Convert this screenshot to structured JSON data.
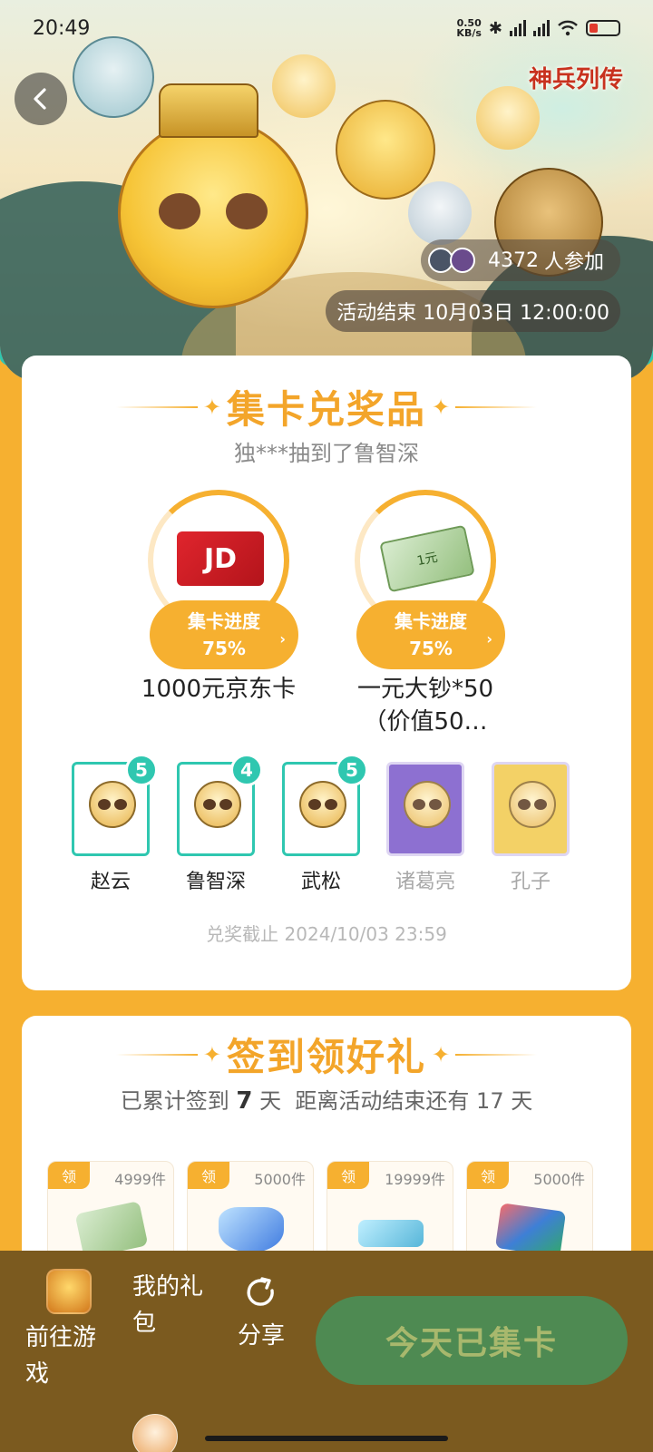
{
  "status_bar": {
    "time": "20:49",
    "net_speed_value": "0.50",
    "net_speed_unit": "KB/s",
    "battery_level": 0.3
  },
  "hero": {
    "logo_text": "神兵列传",
    "participants_count": "4372",
    "participants_suffix": "人参加",
    "end_label": "活动结束 10月03日 12:00:00"
  },
  "collect": {
    "title": "集卡兑奖品",
    "ticker": "独***抽到了鲁智深",
    "prizes": [
      {
        "name": "1000元京东卡",
        "image_text": "JD",
        "progress_label": "集卡进度",
        "progress": "75%",
        "progress_value": 0.75
      },
      {
        "name": "一元大钞*50（价值50…",
        "image_text": "1元",
        "progress_label": "集卡进度",
        "progress": "75%",
        "progress_value": 0.75
      }
    ],
    "heroes": [
      {
        "name": "赵云",
        "count": "5",
        "owned": true
      },
      {
        "name": "鲁智深",
        "count": "4",
        "owned": true
      },
      {
        "name": "武松",
        "count": "5",
        "owned": true
      },
      {
        "name": "诸葛亮",
        "count": "",
        "owned": false
      },
      {
        "name": "孔子",
        "count": "",
        "owned": false
      }
    ],
    "deadline": "兑奖截止 2024/10/03 23:59"
  },
  "signin": {
    "title": "签到领好礼",
    "prefix": "已累计签到",
    "days": "7",
    "unit": "天",
    "remaining_text": "距离活动结束还有 17 天",
    "gifts": [
      {
        "tag": "领",
        "count": "4999件",
        "icon": "cash-icon"
      },
      {
        "tag": "领",
        "count": "5000件",
        "icon": "gem-icon"
      },
      {
        "tag": "领",
        "count": "19999件",
        "icon": "ticket-icon"
      },
      {
        "tag": "领",
        "count": "5000件",
        "icon": "cards-icon"
      }
    ]
  },
  "bottom": {
    "goto_game": "前往游戏",
    "my_gift": "我的礼包",
    "share": "分享",
    "collect_button": "今天已集卡"
  },
  "colors": {
    "accent": "#F6B030",
    "teal": "#2FC7B0",
    "bottom_bar": "#7B5A1F",
    "button": "#4E8A52"
  }
}
